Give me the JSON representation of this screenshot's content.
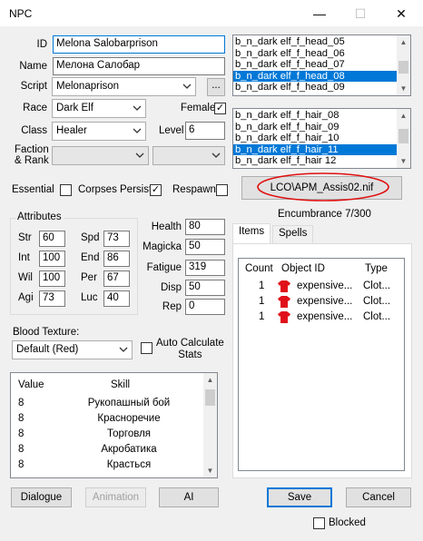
{
  "window": {
    "title": "NPC",
    "min_glyph": "—",
    "max_glyph": "☐",
    "close_glyph": "✕"
  },
  "fields": {
    "id_label": "ID",
    "id_value": "Melona Salobarprison",
    "name_label": "Name",
    "name_value": "Мелона Салобар",
    "script_label": "Script",
    "script_value": "Melonaprison",
    "script_browse": "...",
    "race_label": "Race",
    "race_value": "Dark Elf",
    "female_label": "Female",
    "female_checked": true,
    "class_label": "Class",
    "class_value": "Healer",
    "level_label": "Level",
    "level_value": "6",
    "faction_label_1": "Faction",
    "faction_label_2": "& Rank",
    "faction_value": "",
    "rank_value": ""
  },
  "head_list": {
    "items": [
      "b_n_dark elf_f_head_05",
      "b_n_dark elf_f_head_06",
      "b_n_dark elf_f_head_07",
      "b_n_dark elf_f_head_08",
      "b_n_dark elf_f_head_09"
    ],
    "selected_index": 3
  },
  "hair_list": {
    "items": [
      "b_n_dark elf_f_hair_08",
      "b_n_dark elf_f_hair_09",
      "b_n_dark elf_f_hair_10",
      "b_n_dark elf_f_hair_11",
      "b_n_dark elf_f_hair 12"
    ],
    "selected_index": 3
  },
  "flags": {
    "essential_label": "Essential",
    "essential_checked": false,
    "corpses_label": "Corpses Persist",
    "corpses_checked": true,
    "respawn_label": "Respawn",
    "respawn_checked": false
  },
  "model_button": "LCO\\APM_Assis02.nif",
  "encumbrance": "Encumbrance 7/300",
  "attributes": {
    "title": "Attributes",
    "left": [
      {
        "label": "Str",
        "value": "60"
      },
      {
        "label": "Int",
        "value": "100"
      },
      {
        "label": "Wil",
        "value": "100"
      },
      {
        "label": "Agi",
        "value": "73"
      }
    ],
    "right": [
      {
        "label": "Spd",
        "value": "73"
      },
      {
        "label": "End",
        "value": "86"
      },
      {
        "label": "Per",
        "value": "67"
      },
      {
        "label": "Luc",
        "value": "40"
      }
    ]
  },
  "derived": [
    {
      "label": "Health",
      "value": "80"
    },
    {
      "label": "Magicka",
      "value": "50"
    },
    {
      "label": "Fatigue",
      "value": "319"
    },
    {
      "label": "Disp",
      "value": "50"
    },
    {
      "label": "Rep",
      "value": "0"
    }
  ],
  "blood": {
    "label": "Blood Texture:",
    "value": "Default (Red)"
  },
  "auto_calc": {
    "label_1": "Auto Calculate",
    "label_2": "Stats",
    "checked": false
  },
  "skills": {
    "headers": [
      "Value",
      "Skill"
    ],
    "rows": [
      {
        "value": "8",
        "skill": "Рукопашный бой"
      },
      {
        "value": "8",
        "skill": "Красноречие"
      },
      {
        "value": "8",
        "skill": "Торговля"
      },
      {
        "value": "8",
        "skill": "Акробатика"
      },
      {
        "value": "8",
        "skill": "Красться"
      }
    ]
  },
  "tabs": [
    "Items",
    "Spells"
  ],
  "items_table": {
    "headers": [
      "Count",
      "Object ID",
      "Type"
    ],
    "rows": [
      {
        "count": "1",
        "icon": "red-shirt-icon",
        "object_id": "expensive...",
        "type": "Clot..."
      },
      {
        "count": "1",
        "icon": "red-shirt-icon",
        "object_id": "expensive...",
        "type": "Clot..."
      },
      {
        "count": "1",
        "icon": "red-shirt-icon",
        "object_id": "expensive...",
        "type": "Clot..."
      }
    ]
  },
  "buttons": {
    "dialogue": "Dialogue",
    "animation": "Animation",
    "ai": "AI",
    "save": "Save",
    "cancel": "Cancel"
  },
  "blocked": {
    "label": "Blocked",
    "checked": false
  },
  "colors": {
    "selection": "#0078d7",
    "annotation_red": "#e01010",
    "item_icon": "#e0101a"
  }
}
